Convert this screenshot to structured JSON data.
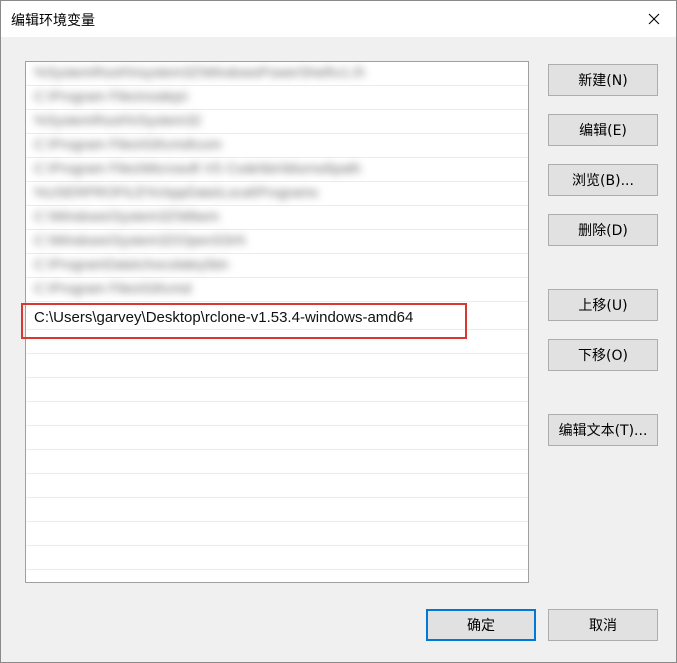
{
  "window": {
    "title": "编辑环境变量"
  },
  "list": {
    "items": [
      "%SystemRoot%\\system32\\WindowsPowerShell\\v1.0\\",
      "C:\\Program Files\\nodejs\\",
      "%SystemRoot%\\System32",
      "C:\\Program Files\\Git\\cmd\\com",
      "C:\\Program Files\\Microsoft VS Code\\bin\\blurred\\path",
      "%USERPROFILE%\\AppData\\Local\\Programs",
      "C:\\Windows\\System32\\Wbem",
      "C:\\Windows\\System32\\OpenSSH\\",
      "C:\\ProgramData\\chocolatey\\bin",
      "C:\\Program Files\\Git\\cmd",
      "C:\\Users\\garvey\\Desktop\\rclone-v1.53.4-windows-amd64"
    ],
    "selected_index": 10
  },
  "buttons": {
    "new": "新建(N)",
    "edit": "编辑(E)",
    "browse": "浏览(B)...",
    "delete": "删除(D)",
    "move_up": "上移(U)",
    "move_down": "下移(O)",
    "edit_text": "编辑文本(T)...",
    "ok": "确定",
    "cancel": "取消"
  },
  "colors": {
    "highlight_border": "#d9372f",
    "primary_button_border": "#0078d7"
  }
}
